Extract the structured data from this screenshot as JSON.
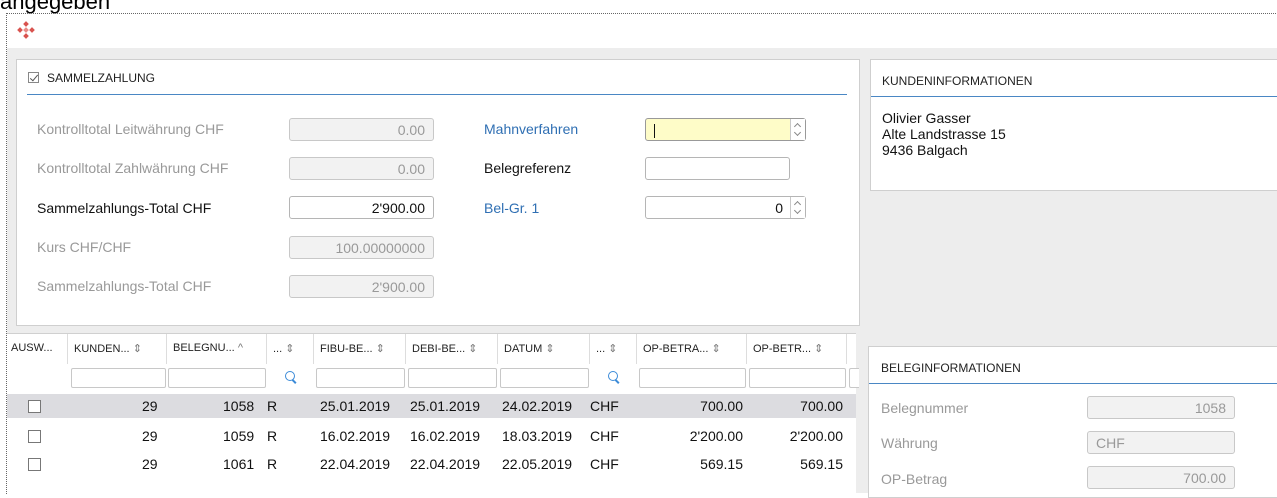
{
  "top_cut_text": "angegeben",
  "sammelzahlung": {
    "title": "SAMMELZAHLUNG",
    "checked": true,
    "left_fields": [
      {
        "label": "Kontrolltotal Leitwährung CHF",
        "value": "0.00"
      },
      {
        "label": "Kontrolltotal Zahlwährung CHF",
        "value": "0.00"
      },
      {
        "label": "Sammelzahlungs-Total CHF",
        "value": "2'900.00"
      },
      {
        "label": "Kurs CHF/CHF",
        "value": "100.00000000"
      },
      {
        "label": "Sammelzahlungs-Total CHF",
        "value": "2'900.00"
      }
    ],
    "right_fields": [
      {
        "label": "Mahnverfahren",
        "value": ""
      },
      {
        "label": "Belegreferenz",
        "value": ""
      },
      {
        "label": "Bel-Gr. 1",
        "value": "0"
      }
    ]
  },
  "kundeninformationen": {
    "title": "KUNDENINFORMATIONEN",
    "lines": [
      "Olivier Gasser",
      "Alte Landstrasse 15",
      "9436 Balgach"
    ]
  },
  "grid": {
    "columns": [
      "AUSW...",
      "KUNDEN...",
      "BELEGNU...",
      "...",
      "FIBU-BE...",
      "DEBI-BE...",
      "DATUM",
      "...",
      "OP-BETRA...",
      "OP-BETR..."
    ],
    "sort_icon": "⇕",
    "sort_asc_icon": "^",
    "rows": [
      {
        "kunde": "29",
        "beleg": "1058",
        "typ": "R",
        "fibu": "25.01.2019",
        "debi": "25.01.2019",
        "datum": "24.02.2019",
        "waehrung": "CHF",
        "op1": "700.00",
        "op2": "700.00",
        "selected": true
      },
      {
        "kunde": "29",
        "beleg": "1059",
        "typ": "R",
        "fibu": "16.02.2019",
        "debi": "16.02.2019",
        "datum": "18.03.2019",
        "waehrung": "CHF",
        "op1": "2'200.00",
        "op2": "2'200.00",
        "selected": false
      },
      {
        "kunde": "29",
        "beleg": "1061",
        "typ": "R",
        "fibu": "22.04.2019",
        "debi": "22.04.2019",
        "datum": "22.05.2019",
        "waehrung": "CHF",
        "op1": "569.15",
        "op2": "569.15",
        "selected": false
      }
    ]
  },
  "beleginformationen": {
    "title": "BELEGINFORMATIONEN",
    "fields": [
      {
        "label": "Belegnummer",
        "value": "1058"
      },
      {
        "label": "Währung",
        "value": "CHF"
      },
      {
        "label": "OP-Betrag",
        "value": "700.00"
      }
    ]
  },
  "colors": {
    "accent": "#4a87c4",
    "link_blue": "#2f6fb3",
    "focus_yellow": "#fefcc8",
    "logo_red": "#d9534f"
  }
}
